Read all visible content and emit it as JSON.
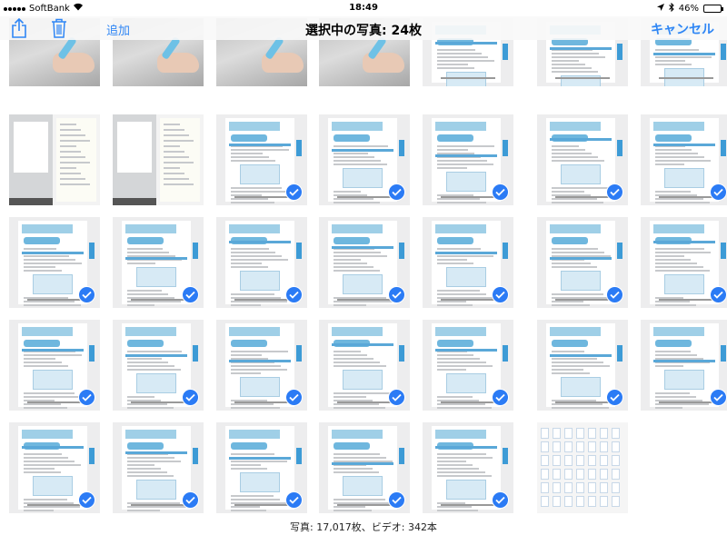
{
  "status_bar": {
    "carrier": "SoftBank",
    "time": "18:49",
    "battery": "46%",
    "battery_level": 0.46
  },
  "toolbar": {
    "add_label": "追加",
    "title": "選択中の写真: 24枚",
    "cancel_label": "キャンセル"
  },
  "footer": {
    "count_text": "写真: 17,017枚、ビデオ: 342本"
  },
  "colors": {
    "accent": "#2f86f5",
    "checkmark": "#2b7bf5"
  },
  "grid": {
    "rows": [
      [
        {
          "type": "hand",
          "selected": false
        },
        {
          "type": "hand",
          "selected": false
        },
        {
          "type": "hand",
          "selected": false
        },
        {
          "type": "hand",
          "selected": false
        },
        {
          "type": "doc",
          "selected": false
        },
        {
          "type": "doc",
          "selected": false
        },
        {
          "type": "doc",
          "selected": false
        }
      ],
      [
        {
          "type": "sheet",
          "selected": false
        },
        {
          "type": "sheet",
          "selected": false
        },
        {
          "type": "doc",
          "selected": true
        },
        {
          "type": "doc",
          "selected": true
        },
        {
          "type": "doc",
          "selected": true
        },
        {
          "type": "doc",
          "selected": true
        },
        {
          "type": "doc",
          "selected": true
        }
      ],
      [
        {
          "type": "doc",
          "selected": true
        },
        {
          "type": "doc",
          "selected": true
        },
        {
          "type": "doc",
          "selected": true
        },
        {
          "type": "doc",
          "selected": true
        },
        {
          "type": "doc",
          "selected": true
        },
        {
          "type": "doc",
          "selected": true
        },
        {
          "type": "doc",
          "selected": true
        }
      ],
      [
        {
          "type": "doc",
          "selected": true
        },
        {
          "type": "doc",
          "selected": true
        },
        {
          "type": "doc",
          "selected": true
        },
        {
          "type": "doc",
          "selected": true
        },
        {
          "type": "doc",
          "selected": true
        },
        {
          "type": "doc",
          "selected": true
        },
        {
          "type": "doc",
          "selected": true
        }
      ],
      [
        {
          "type": "doc",
          "selected": true
        },
        {
          "type": "doc",
          "selected": true
        },
        {
          "type": "doc",
          "selected": true
        },
        {
          "type": "doc",
          "selected": true
        },
        {
          "type": "doc",
          "selected": true
        },
        {
          "type": "collage",
          "selected": false
        }
      ]
    ]
  }
}
